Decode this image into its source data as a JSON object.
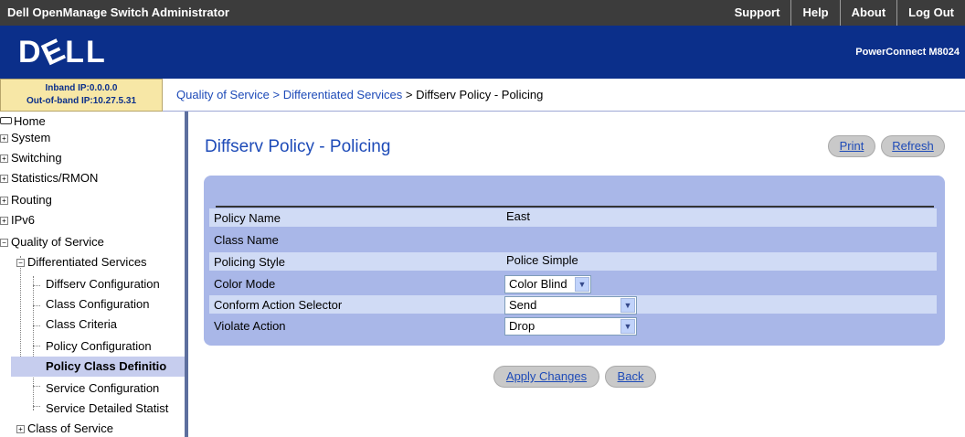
{
  "titlebar": {
    "app_title": "Dell OpenManage Switch Administrator",
    "nav": [
      "Support",
      "Help",
      "About",
      "Log Out"
    ]
  },
  "banner": {
    "logo_text": "DELL",
    "product": "PowerConnect M8024"
  },
  "ip": {
    "inband": "Inband IP:0.0.0.0",
    "outofband": "Out-of-band IP:10.27.5.31"
  },
  "breadcrumb": {
    "items": [
      "Quality of Service",
      "Differentiated Services",
      "Diffserv Policy - Policing"
    ],
    "separator": ">"
  },
  "sidebar": {
    "items": [
      {
        "label": "Home"
      },
      {
        "label": "System",
        "expander": "+"
      },
      {
        "label": "Switching",
        "expander": "+"
      },
      {
        "label": "Statistics/RMON",
        "expander": "+"
      },
      {
        "label": "Routing",
        "expander": "+"
      },
      {
        "label": "IPv6",
        "expander": "+"
      },
      {
        "label": "Quality of Service",
        "expander": "−"
      },
      {
        "label": "Differentiated Services",
        "expander": "−"
      },
      {
        "label": "Diffserv Configuration"
      },
      {
        "label": "Class Configuration"
      },
      {
        "label": "Class Criteria"
      },
      {
        "label": "Policy Configuration"
      },
      {
        "label": "Policy Class Definitio"
      },
      {
        "label": "Service Configuration"
      },
      {
        "label": "Service Detailed Statist"
      },
      {
        "label": "Class of Service",
        "expander": "+"
      }
    ],
    "selected": "Policy Class Definitio"
  },
  "main": {
    "title": "Diffserv Policy - Policing",
    "print_label": "Print",
    "refresh_label": "Refresh",
    "rows": [
      {
        "label": "Policy Name",
        "value": "East"
      },
      {
        "label": "Class Name",
        "value": ""
      },
      {
        "label": "Policing Style",
        "value": "Police Simple"
      },
      {
        "label": "Color Mode",
        "value": "Color Blind"
      },
      {
        "label": "Conform Action Selector",
        "value": "Send"
      },
      {
        "label": "Violate Action",
        "value": "Drop"
      }
    ],
    "apply_label": "Apply Changes",
    "back_label": "Back"
  },
  "colors": {
    "titlebar": "#3c3c3c",
    "banner": "#0b2f8a",
    "panel": "#a9b7e8",
    "row_light": "#d0dbf5",
    "link": "#1e4bb8"
  }
}
